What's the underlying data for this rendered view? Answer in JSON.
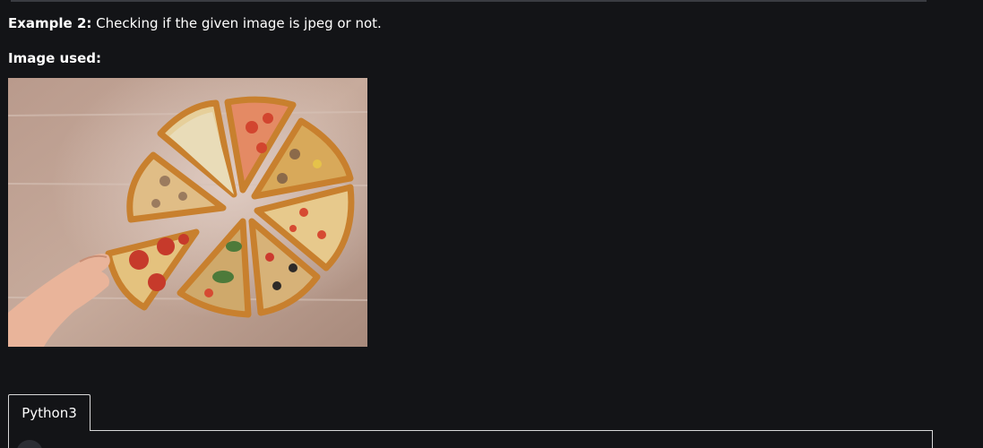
{
  "article": {
    "example_bold": "Example 2:",
    "example_text": " Checking if the given image is jpeg or not.",
    "image_used_label": "Image used:"
  },
  "figure": {
    "subject": "pizza slices photo"
  },
  "code_block": {
    "tab_label": "Python3"
  },
  "colors": {
    "background": "#131417",
    "text": "#ffffff",
    "border": "#d8d8d8"
  }
}
